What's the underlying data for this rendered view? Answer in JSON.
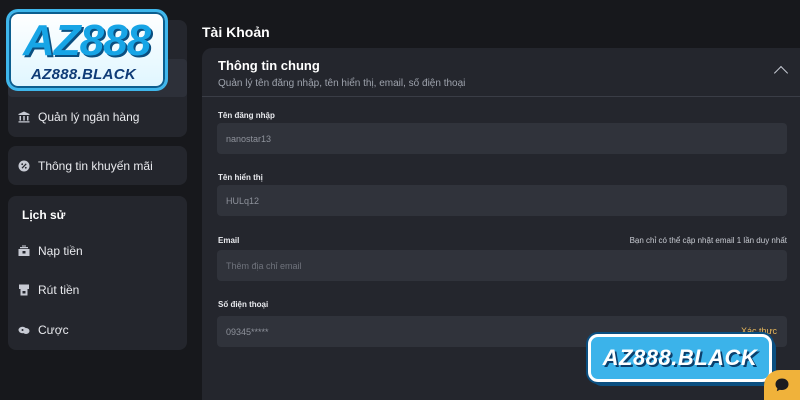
{
  "logo": {
    "main": "AZ888",
    "sub": "AZ888.BLACK"
  },
  "sidebar": {
    "items": [
      {
        "label": "Quản lý ngân hàng",
        "icon": "bank-icon"
      },
      {
        "label": "Thông tin khuyến mãi",
        "icon": "gift-icon"
      }
    ],
    "history": {
      "title": "Lịch sử",
      "items": [
        {
          "label": "Nạp tiền",
          "icon": "deposit-icon"
        },
        {
          "label": "Rút tiền",
          "icon": "withdraw-icon"
        },
        {
          "label": "Cược",
          "icon": "bet-icon"
        }
      ]
    }
  },
  "page": {
    "title": "Tài Khoản"
  },
  "general": {
    "title": "Thông tin chung",
    "subtitle": "Quản lý tên đăng nhập, tên hiển thị, email, số điện thoại",
    "fields": {
      "username": {
        "label": "Tên đăng nhập",
        "value": "nanostar13"
      },
      "display_name": {
        "label": "Tên hiển thị",
        "value": "HULq12"
      },
      "email": {
        "label": "Email",
        "value": "",
        "placeholder": "Thêm địa chỉ email",
        "note": "Bạn chỉ có thể cập nhật email 1 lần duy nhất"
      },
      "phone": {
        "label": "Số điện thoại",
        "value": "09345*****",
        "action": "Xác thực"
      }
    }
  },
  "watermark": {
    "text": "AZ888.BLACK"
  },
  "colors": {
    "background": "#17181c",
    "card": "#24262d",
    "input": "#30333b",
    "accent_gold": "#e6b65a",
    "brand_blue": "#3bb3ea"
  }
}
